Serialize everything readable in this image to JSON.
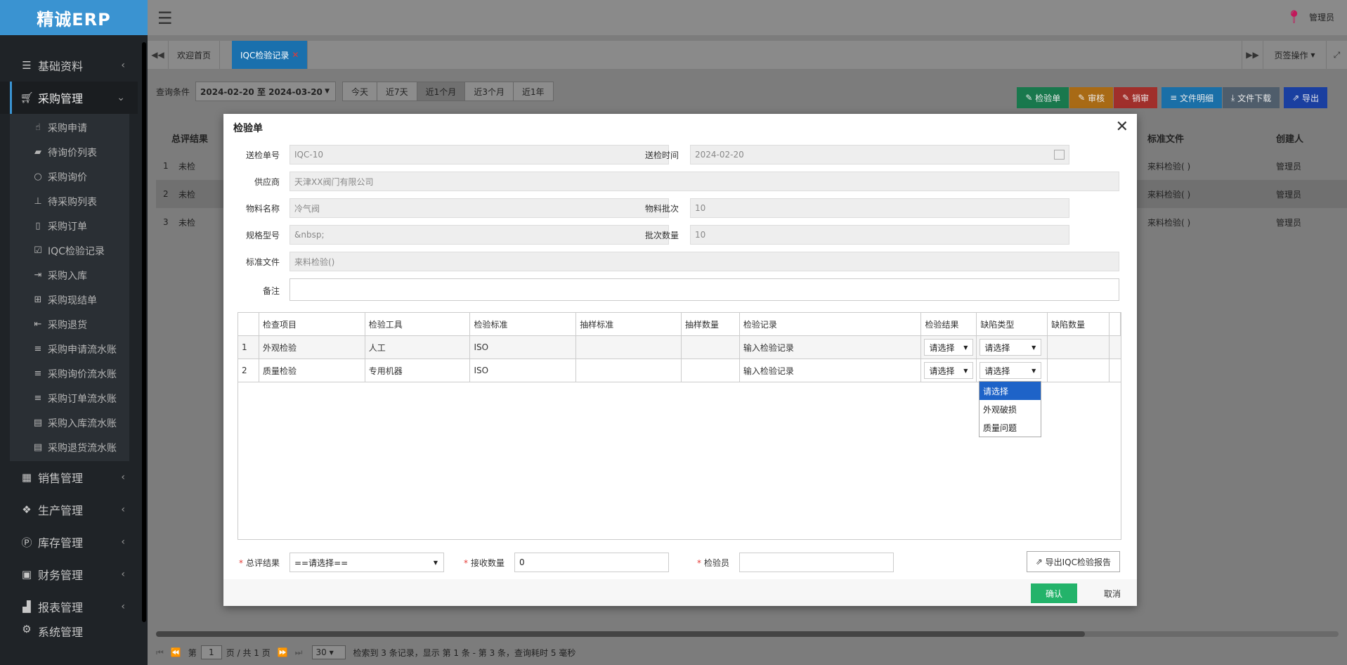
{
  "app": {
    "logo": "精诚ERP",
    "user": "管理员"
  },
  "sidebar": {
    "items": [
      {
        "label": "基础资料",
        "icon": "list-icon",
        "open": false
      },
      {
        "label": "采购管理",
        "icon": "cart-icon",
        "open": true
      },
      {
        "label": "销售管理",
        "icon": "building-icon",
        "open": false
      },
      {
        "label": "生产管理",
        "icon": "cubes-icon",
        "open": false
      },
      {
        "label": "库存管理",
        "icon": "parking-icon",
        "open": false
      },
      {
        "label": "财务管理",
        "icon": "money-icon",
        "open": false
      },
      {
        "label": "报表管理",
        "icon": "chart-icon",
        "open": false
      },
      {
        "label": "系统管理",
        "icon": "gear-icon",
        "open": false
      }
    ],
    "submenu": [
      {
        "label": "采购申请",
        "icon": "hand-icon"
      },
      {
        "label": "待询价列表",
        "icon": "eraser-icon"
      },
      {
        "label": "采购询价",
        "icon": "circle-icon"
      },
      {
        "label": "待采购列表",
        "icon": "pin-icon"
      },
      {
        "label": "采购订单",
        "icon": "file-icon"
      },
      {
        "label": "IQC检验记录",
        "icon": "check-square-icon"
      },
      {
        "label": "采购入库",
        "icon": "sign-in-icon"
      },
      {
        "label": "采购现结单",
        "icon": "cart-icon"
      },
      {
        "label": "采购退货",
        "icon": "sign-out-icon"
      },
      {
        "label": "采购申请流水账",
        "icon": "list-icon"
      },
      {
        "label": "采购询价流水账",
        "icon": "list-icon"
      },
      {
        "label": "采购订单流水账",
        "icon": "list-icon"
      },
      {
        "label": "采购入库流水账",
        "icon": "file-text-icon"
      },
      {
        "label": "采购退货流水账",
        "icon": "file-text-icon"
      }
    ]
  },
  "tabs": {
    "home": "欢迎首页",
    "active": "IQC检验记录",
    "ops": "页签操作"
  },
  "filter": {
    "label": "查询条件",
    "range": "2024-02-20 至 2024-03-20",
    "quick": [
      "今天",
      "近7天",
      "近1个月",
      "近3个月",
      "近1年"
    ],
    "active_quick": "近1个月"
  },
  "actions": {
    "inspect": "检验单",
    "audit": "审核",
    "cancel_audit": "销审",
    "file_detail": "文件明细",
    "file_download": "文件下载",
    "export": "导出"
  },
  "bg_table": {
    "headers": {
      "result": "总评结果",
      "std": "标准文件",
      "creator": "创建人"
    },
    "rows": [
      {
        "no": "1",
        "result": "未检",
        "std": "来料检验( )",
        "creator": "管理员"
      },
      {
        "no": "2",
        "result": "未检",
        "std": "来料检验( )",
        "creator": "管理员"
      },
      {
        "no": "3",
        "result": "未检",
        "std": "来料检验( )",
        "creator": "管理员"
      }
    ]
  },
  "pager": {
    "page_prefix": "第",
    "page": "1",
    "page_suffix": "页 / 共 1 页",
    "size": "30",
    "info": "检索到 3 条记录，显示 第 1 条 - 第 3 条，查询耗时 5 毫秒"
  },
  "modal": {
    "title": "检验单",
    "fields": {
      "order_no_label": "送检单号",
      "order_no": "IQC-10",
      "time_label": "送检时间",
      "time": "2024-02-20",
      "supplier_label": "供应商",
      "supplier": "天津XX阀门有限公司",
      "material_label": "物料名称",
      "material": "冷气阀",
      "batch_label": "物料批次",
      "batch": "10",
      "spec_label": "规格型号",
      "spec": "&nbsp;",
      "qty_label": "批次数量",
      "qty": "10",
      "std_label": "标准文件",
      "std": "来料检验()",
      "remark_label": "备注",
      "remark": ""
    },
    "item_headers": [
      "检查项目",
      "检验工具",
      "检验标准",
      "抽样标准",
      "抽样数量",
      "检验记录",
      "检验结果",
      "缺陷类型",
      "缺陷数量"
    ],
    "items": [
      {
        "no": "1",
        "item": "外观检验",
        "tool": "人工",
        "std": "ISO",
        "sample_std": "",
        "sample_qty": "",
        "record_ph": "输入检验记录",
        "result": "请选择",
        "defect": "请选择",
        "defect_qty": ""
      },
      {
        "no": "2",
        "item": "质量检验",
        "tool": "专用机器",
        "std": "ISO",
        "sample_std": "",
        "sample_qty": "",
        "record_ph": "输入检验记录",
        "result": "请选择",
        "defect": "请选择",
        "defect_qty": ""
      }
    ],
    "dropdown": [
      "请选择",
      "外观破损",
      "质量问题"
    ],
    "bottom": {
      "overall_label": "总评结果",
      "overall": "==请选择==",
      "accept_label": "接收数量",
      "accept": "0",
      "inspector_label": "检验员",
      "inspector": "",
      "export_report": "导出IQC检验报告"
    },
    "confirm": "确认",
    "cancel": "取消"
  }
}
